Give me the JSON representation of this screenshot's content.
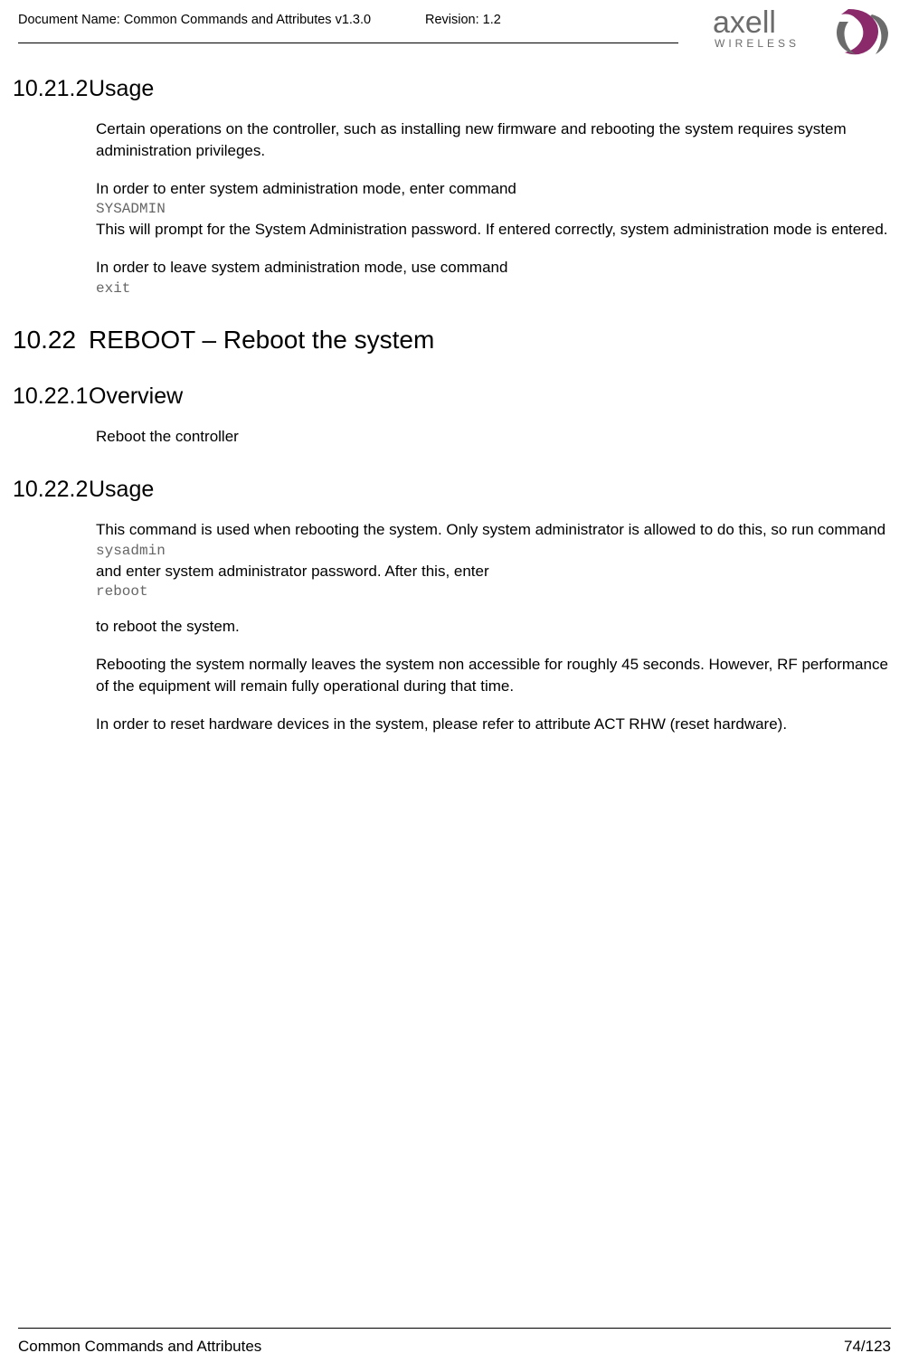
{
  "header": {
    "document_name_label": "Document Name: Common Commands and Attributes v1.3.0",
    "revision_label": "Revision: 1.2",
    "logo_brand_top": "axell",
    "logo_brand_bottom": "WIRELESS"
  },
  "sections": {
    "s10_21_2": {
      "num": "10.21.2",
      "title": "Usage",
      "p1": "Certain operations on the controller, such as installing new firmware and rebooting the system requires system administration privileges.",
      "p2": "In order to enter system administration mode, enter command",
      "code1": "SYSADMIN",
      "p3": "This will prompt for the System Administration password. If entered correctly, system administration mode is entered.",
      "p4": "In order to leave system administration mode, use command",
      "code2": "exit"
    },
    "s10_22": {
      "num": "10.22",
      "title": "REBOOT – Reboot the system"
    },
    "s10_22_1": {
      "num": "10.22.1",
      "title": "Overview",
      "p1": "Reboot the controller"
    },
    "s10_22_2": {
      "num": "10.22.2",
      "title": "Usage",
      "p1": "This command is used when rebooting the system.  Only system administrator is allowed to do this, so run command",
      "code1": "sysadmin",
      "p2": "and enter system administrator password. After this, enter",
      "code2": "reboot",
      "p3": "to reboot the system.",
      "p4": "Rebooting the system normally leaves the system non accessible for roughly 45 seconds. However, RF performance of the equipment will remain fully operational during that time.",
      "p5": "In order to reset hardware devices in the system, please refer to attribute ACT RHW (reset hardware)."
    }
  },
  "footer": {
    "left": "Common Commands and Attributes",
    "right": "74/123"
  }
}
